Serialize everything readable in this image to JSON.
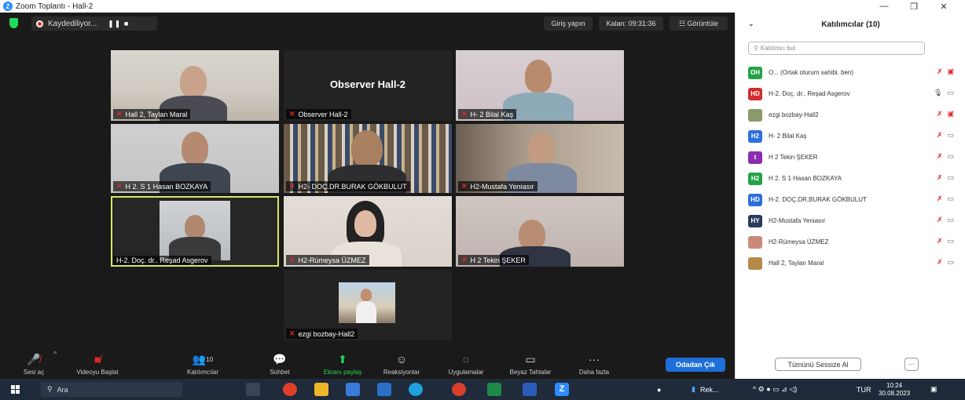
{
  "window": {
    "title": "Zoom Toplantı - Hall-2",
    "logo_letter": "Z",
    "minimize": "—",
    "restore": "❐",
    "close": "✕"
  },
  "topbar": {
    "recording_label": "Kaydediliyor...",
    "recording_controls": "❚❚ ■",
    "sign_in": "Giriş yapın",
    "remaining": "Kalan: 09:31:36",
    "view": "☷ Görüntüle"
  },
  "tiles": [
    {
      "label": "Hall 2, Taylan Maral"
    },
    {
      "label": "Observer Hall-2",
      "center_name": "Observer Hall-2"
    },
    {
      "label": "H- 2 Bilal Kaş"
    },
    {
      "label": "H 2. S 1 Hasan BOZKAYA"
    },
    {
      "label": "H2- DOÇ.DR.BURAK GÖKBULUT"
    },
    {
      "label": "H2-Mustafa Yeniasır"
    },
    {
      "label": "H-2. Doç. dr.. Reşad Asgerov"
    },
    {
      "label": "H2-Rümeysa ÜZMEZ"
    },
    {
      "label": "H 2 Tekin ŞEKER"
    },
    {
      "label": "ezgi bozbay-Hall2"
    }
  ],
  "toolbar": {
    "unmute": "Sesi aç",
    "start_video": "Videoyu Başlat",
    "participants": "Katılımcılar",
    "participants_count": "10",
    "chat": "Sohbet",
    "share": "Ekranı paylaş",
    "reactions": "Reaksiyonlar",
    "apps": "Uygulamalar",
    "whiteboard": "Beyaz Tahtalar",
    "more": "Daha fazla",
    "leave": "Odadan Çık"
  },
  "panel": {
    "title": "Katılımcılar (10)",
    "search_placeholder": "Katılımcı bul",
    "mute_all": "Tümünü Sessize Al",
    "more": "···",
    "participants": [
      {
        "initials": "OH",
        "color": "#23a247",
        "name": "O... (Ortak oturum sahibi, ben)"
      },
      {
        "initials": "HD",
        "color": "#d12d2d",
        "name": "H-2. Doç. dr., Reşad Asgerov"
      },
      {
        "initials": "",
        "color": "#8a9a6a",
        "name": "ezgi bozbay-Hall2"
      },
      {
        "initials": "H2",
        "color": "#2d6fd8",
        "name": "H- 2 Bilal Kaş"
      },
      {
        "initials": "t",
        "color": "#8a2db0",
        "name": "H 2 Tekin ŞEKER"
      },
      {
        "initials": "H2",
        "color": "#23a247",
        "name": "H 2. S 1 Hasan BOZKAYA"
      },
      {
        "initials": "HD",
        "color": "#2d6fd8",
        "name": "H-2. DOÇ.DR.BURAK GÖKBULUT"
      },
      {
        "initials": "HY",
        "color": "#2a3a5c",
        "name": "H2-Mustafa Yeniasır"
      },
      {
        "initials": "",
        "color": "#c98a7a",
        "name": "H2-Rümeysa ÜZMEZ"
      },
      {
        "initials": "",
        "color": "#b58a4a",
        "name": "Hall 2, Taylan Maral"
      }
    ]
  },
  "taskbar": {
    "search": "Ara",
    "rec_app": "Rek...",
    "lang": "TUR",
    "time": "10:24",
    "date": "30.08.2023"
  }
}
